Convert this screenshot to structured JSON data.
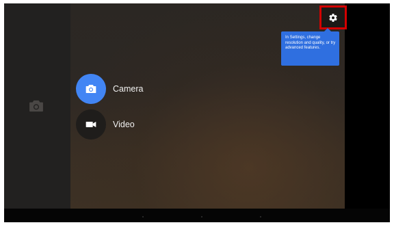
{
  "settings": {
    "tooltip": "In Settings, change resolution and quality, or try advanced features."
  },
  "modes": {
    "camera_label": "Camera",
    "video_label": "Video"
  },
  "colors": {
    "accent": "#4285f4",
    "tooltip_bg": "#2f6fe0",
    "highlight_border": "#d40000"
  },
  "icons": {
    "settings": "gear-icon",
    "camera": "camera-icon",
    "video": "video-icon",
    "left_shortcut": "camera-icon"
  }
}
